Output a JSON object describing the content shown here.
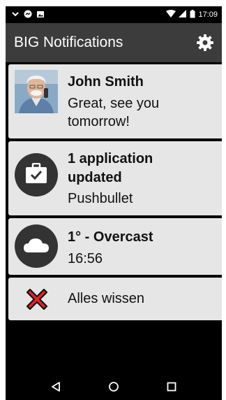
{
  "status_bar": {
    "time": "17:09",
    "left_icons": [
      "chevron-down-icon",
      "messenger-icon",
      "image-icon"
    ],
    "right_icons": [
      "wifi-icon",
      "signal-icon",
      "battery-icon"
    ]
  },
  "app_bar": {
    "title": "BIG Notifications",
    "settings_icon": "gear-icon"
  },
  "notifications": [
    {
      "icon": "contact-photo",
      "title": "John Smith",
      "line1": "Great, see you",
      "line2": "tomorrow!"
    },
    {
      "icon": "briefcase-check-icon",
      "title_line1": "1 application",
      "title_line2": "updated",
      "text": "Pushbullet"
    },
    {
      "icon": "cloud-icon",
      "title": "1° - Overcast",
      "text": "16:56"
    }
  ],
  "clear_all": {
    "label": "Alles wissen",
    "icon": "red-x-icon"
  },
  "nav_bar": {
    "buttons": [
      "back-icon",
      "home-icon",
      "recents-icon"
    ]
  },
  "colors": {
    "app_bar": "#3c3c3c",
    "card": "#e6e6e6",
    "icon_bg": "#333333",
    "clear_x": "#e8202a"
  }
}
